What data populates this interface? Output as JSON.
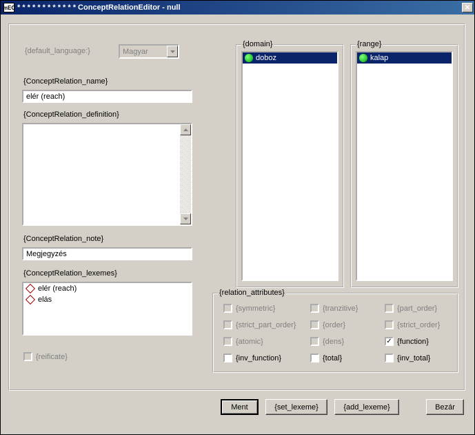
{
  "window": {
    "title": "* * * * * * * * * * * * ConceptRelationEditor - null",
    "icon_text": "mEC"
  },
  "labels": {
    "default_language": "{default_language:}",
    "name": "{ConceptRelation_name}",
    "definition": "{ConceptRelation_definition}",
    "note": "{ConceptRelation_note}",
    "lexemes": "{ConceptRelation_lexemes}",
    "reificate": "{reificate}",
    "domain": "{domain}",
    "range": "{range}",
    "relation_attributes": "{relation_attributes}"
  },
  "values": {
    "language": "Magyar",
    "name": "elér (reach)",
    "definition": "",
    "note": "Megjegyzés"
  },
  "lexemes": [
    "elér (reach)",
    "elás"
  ],
  "domain_items": [
    "doboz"
  ],
  "range_items": [
    "kalap"
  ],
  "attributes": {
    "symmetric": {
      "label": "{symmetric}",
      "checked": false,
      "enabled": false
    },
    "tranzitive": {
      "label": "{tranzitive}",
      "checked": false,
      "enabled": false
    },
    "part_order": {
      "label": "{part_order}",
      "checked": false,
      "enabled": false
    },
    "strict_part_order": {
      "label": "{strict_part_order}",
      "checked": false,
      "enabled": false
    },
    "order": {
      "label": "{order}",
      "checked": false,
      "enabled": false
    },
    "strict_order": {
      "label": "{strict_order}",
      "checked": false,
      "enabled": false
    },
    "atomic": {
      "label": "{atomic}",
      "checked": false,
      "enabled": false
    },
    "dens": {
      "label": "{dens}",
      "checked": false,
      "enabled": false
    },
    "function": {
      "label": "{function}",
      "checked": true,
      "enabled": true
    },
    "inv_function": {
      "label": "{inv_function}",
      "checked": false,
      "enabled": true
    },
    "total": {
      "label": "{total}",
      "checked": false,
      "enabled": true
    },
    "inv_total": {
      "label": "{inv_total}",
      "checked": false,
      "enabled": true
    }
  },
  "buttons": {
    "save": "Ment",
    "set_lexeme": "{set_lexeme}",
    "add_lexeme": "{add_lexeme}",
    "close": "Bezár"
  }
}
